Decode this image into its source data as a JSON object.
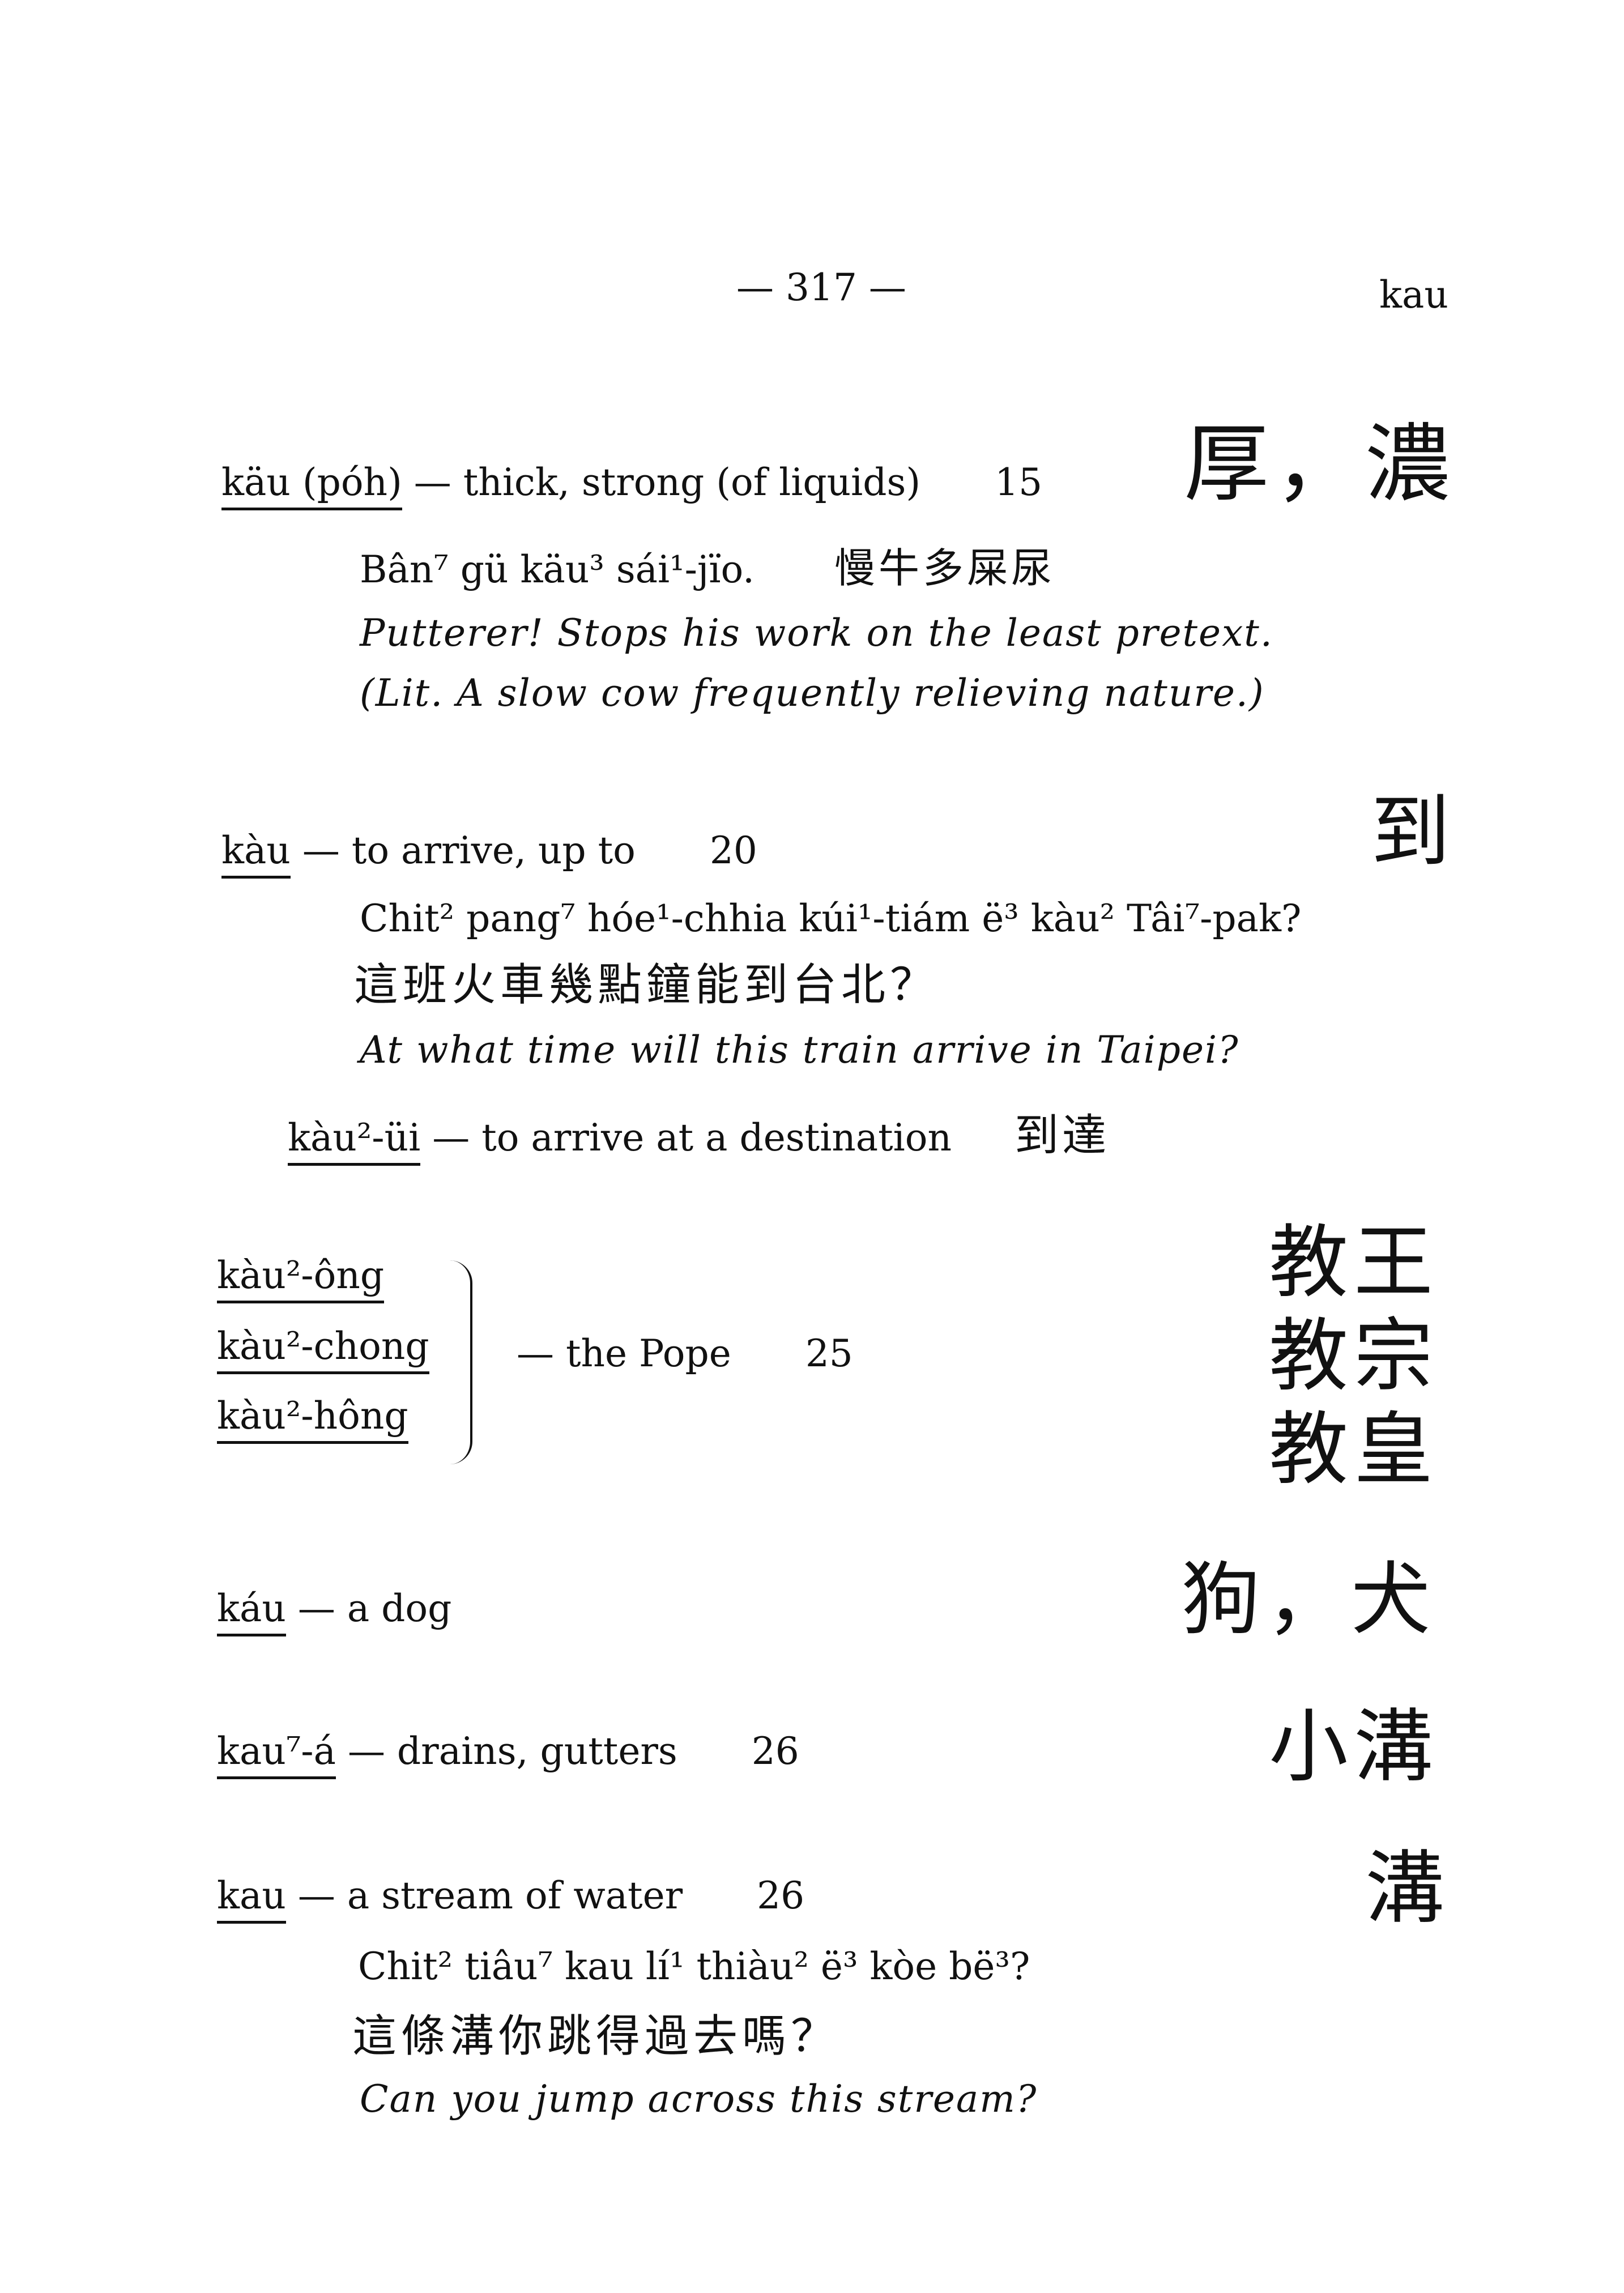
{
  "header": {
    "page_number": "— 317 —",
    "running_head": "kau"
  },
  "entries": [
    {
      "headword": "käu (póh)",
      "definition": " — thick, strong (of liquids)",
      "ref": "15",
      "chinese": "厚，濃",
      "examples": [
        {
          "romanized": "Bân⁷ gü käu³ sái¹-jïo.",
          "chinese": "慢牛多屎尿"
        }
      ],
      "translation": "Putterer!  Stops his work on the least pretext.",
      "literal": "(Lit. A slow cow frequently relieving nature.)"
    },
    {
      "headword": "kàu",
      "definition": " — to arrive, up to",
      "ref": "20",
      "chinese": "到",
      "example_romanized": "Chit² pang⁷ hóe¹-chhia kúi¹-tiám ë³ kàu² Tâi⁷-pak?",
      "example_chinese": "這班火車幾點鐘能到台北？",
      "translation": "At what time will this train arrive in Taipei?",
      "sub": {
        "headword": "kàu²-üi",
        "definition": " — to arrive at a destination",
        "chinese": "到達"
      }
    },
    {
      "headwords": [
        "kàu²-ông",
        "kàu²-chong",
        "kàu²-hông"
      ],
      "definition": "— the Pope",
      "ref": "25",
      "chinese": [
        "教王",
        "教宗",
        "教皇"
      ]
    },
    {
      "headword": "káu",
      "definition": " — a dog",
      "chinese": "狗，犬"
    },
    {
      "headword": "kau⁷-á",
      "definition": " — drains, gutters",
      "ref": "26",
      "chinese": "小溝"
    },
    {
      "headword": "kau",
      "definition": " — a stream of water",
      "ref": "26",
      "chinese": "溝",
      "example_romanized": "Chit² tiâu⁷ kau lí¹ thiàu² ë³ kòe bë³?",
      "example_chinese": "這條溝你跳得過去嗎？",
      "translation": "Can you jump across this stream?"
    }
  ]
}
